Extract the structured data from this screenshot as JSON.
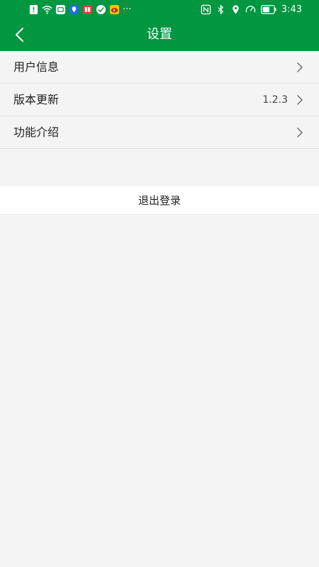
{
  "status_bar": {
    "time": "3:43",
    "overflow": "···",
    "left_icons": [
      "alert-icon",
      "wifi-icon",
      "message-app-icon",
      "location-app-icon",
      "book-app-icon",
      "vpn-app-icon",
      "weibo-icon"
    ],
    "right_icons": [
      "nfc-icon",
      "bluetooth-icon",
      "location-icon",
      "speed-icon",
      "battery-icon"
    ]
  },
  "header": {
    "title": "设置",
    "back_icon": "chevron-left-icon"
  },
  "menu": {
    "items": [
      {
        "label": "用户信息",
        "value": ""
      },
      {
        "label": "版本更新",
        "value": "1.2.3"
      },
      {
        "label": "功能介绍",
        "value": ""
      }
    ]
  },
  "logout": {
    "label": "退出登录"
  },
  "colors": {
    "primary": "#019640",
    "background": "#f4f4f4",
    "text": "#222222"
  }
}
